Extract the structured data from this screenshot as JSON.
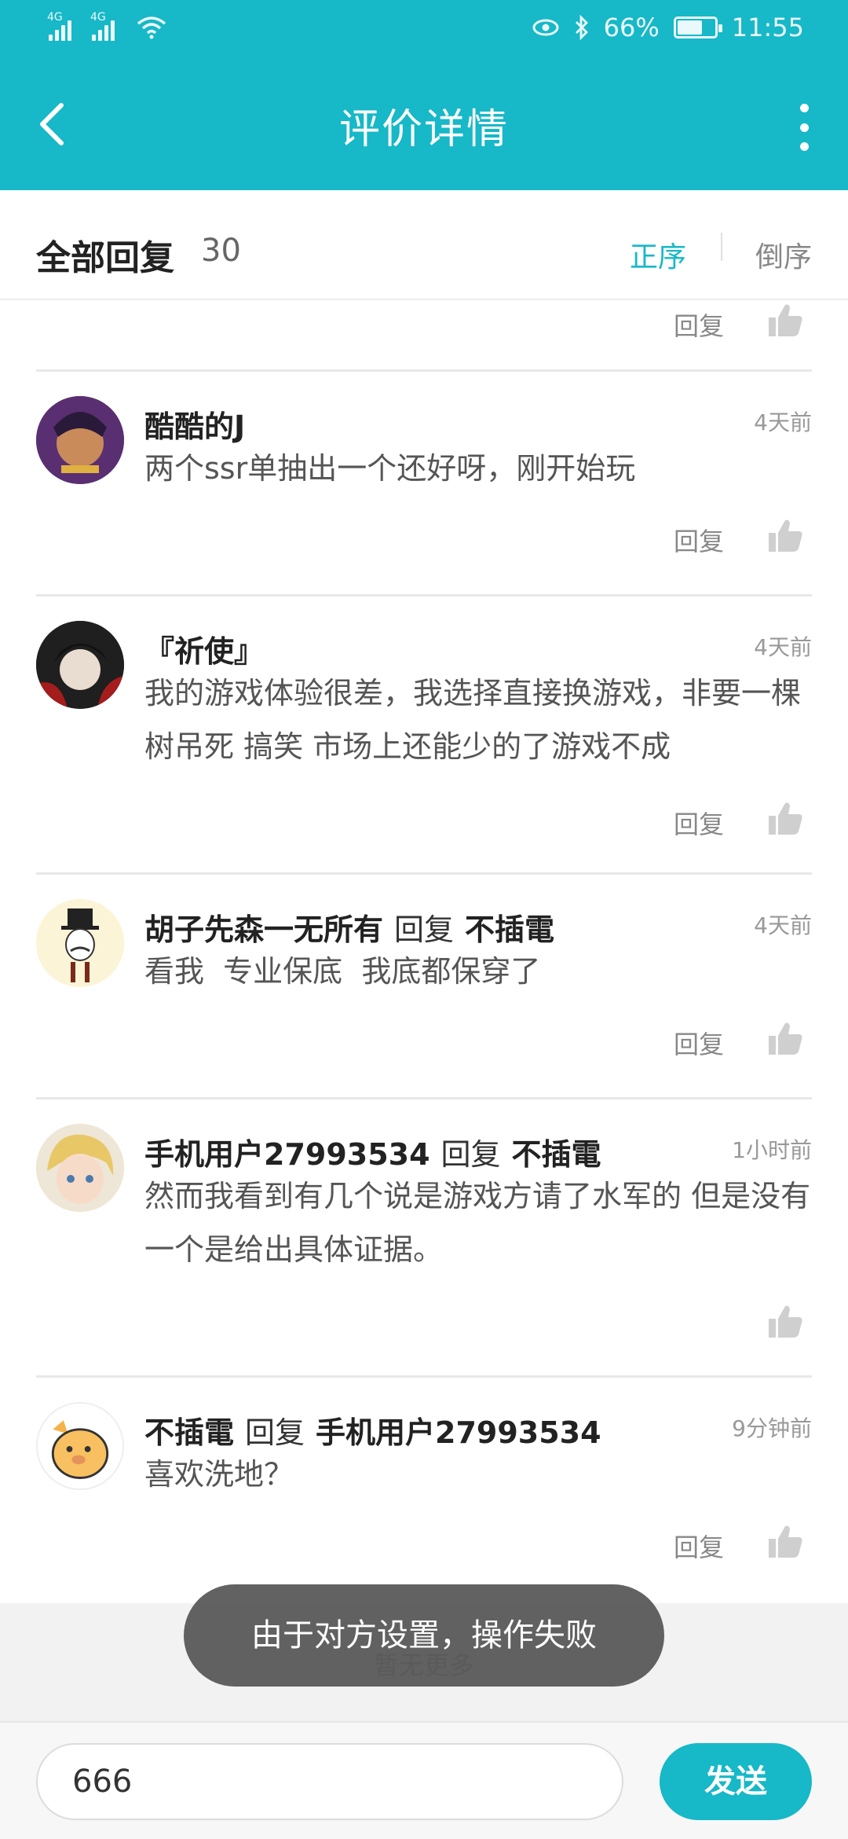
{
  "status_bar": {
    "signal1": "4G",
    "signal2": "4G",
    "battery_percent": "66%",
    "time": "11:55"
  },
  "nav": {
    "title": "评价详情"
  },
  "replies_header": {
    "title": "全部回复",
    "count": "30",
    "sort_asc": "正序",
    "sort_desc": "倒序"
  },
  "reply_label": "回复",
  "comments": [
    {
      "name": "酷酷的J",
      "time": "4天前",
      "text": "两个ssr单抽出一个还好呀，刚开始玩"
    },
    {
      "name": "『祈使』",
      "time": "4天前",
      "text": "我的游戏体验很差，我选择直接换游戏，非要一棵树吊死 搞笑 市场上还能少的了游戏不成"
    },
    {
      "name": "胡子先森一无所有",
      "reply_word": "回复",
      "reply_to": "不插電",
      "time": "4天前",
      "text": "看我  专业保底  我底都保穿了"
    },
    {
      "name": "手机用户27993534",
      "reply_word": "回复",
      "reply_to": "不插電",
      "time": "1小时前",
      "text": "然而我看到有几个说是游戏方请了水军的 但是没有一个是给出具体证据。"
    },
    {
      "name": "不插電",
      "reply_word": "回复",
      "reply_to": "手机用户27993534",
      "time": "9分钟前",
      "text": "喜欢洗地？"
    }
  ],
  "no_more": "暂无更多",
  "toast": "由于对方设置，操作失败",
  "input": {
    "value": "666"
  },
  "send_label": "发送",
  "colors": {
    "brand": "#17b8c7",
    "toast_bg": "#555555"
  }
}
